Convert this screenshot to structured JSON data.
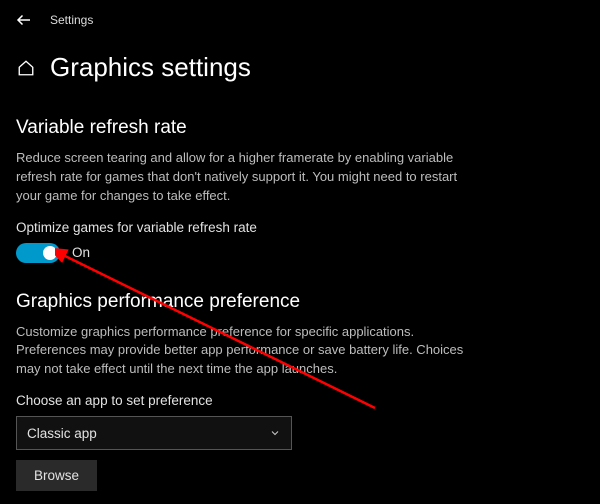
{
  "top": {
    "title": "Settings"
  },
  "page": {
    "heading": "Graphics settings"
  },
  "section1": {
    "title": "Variable refresh rate",
    "desc": "Reduce screen tearing and allow for a higher framerate by enabling variable refresh rate for games that don't natively support it. You might need to restart your game for changes to take effect.",
    "option_label": "Optimize games for variable refresh rate",
    "toggle_state": "On"
  },
  "section2": {
    "title": "Graphics performance preference",
    "desc": "Customize graphics performance preference for specific applications. Preferences may provide better app performance or save battery life. Choices may not take effect until the next time the app launches.",
    "choose_label": "Choose an app to set preference",
    "dropdown_value": "Classic app",
    "browse_label": "Browse"
  },
  "colors": {
    "toggle_on": "#0099cc",
    "annotation": "#ff0000"
  }
}
